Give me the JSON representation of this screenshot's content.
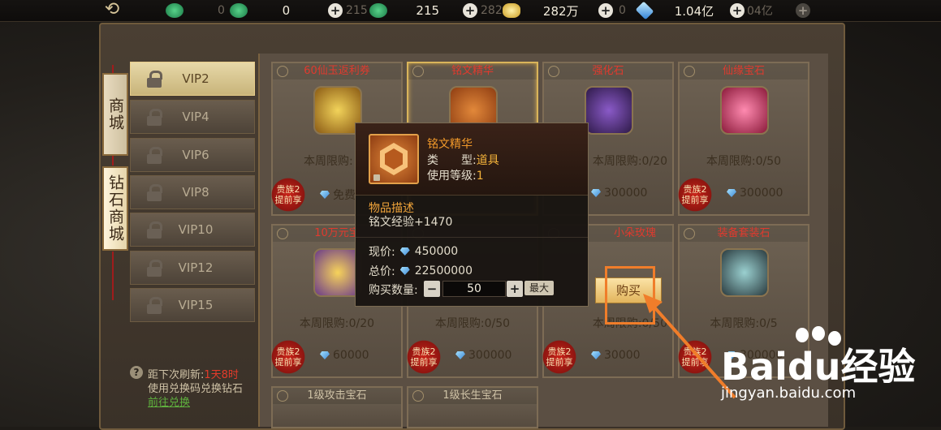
{
  "currencies": [
    {
      "prefix": "0",
      "value": "0"
    },
    {
      "prefix": "215",
      "value": "215"
    },
    {
      "prefix": "282",
      "value": "282万"
    },
    {
      "prefix": "0",
      "value": "1.04亿"
    }
  ],
  "ghost_value": "04亿",
  "side_tabs": {
    "shop": "商城",
    "diamond_shop": "钻石商城"
  },
  "vip_tabs": [
    "VIP2",
    "VIP4",
    "VIP6",
    "VIP8",
    "VIP10",
    "VIP12",
    "VIP15"
  ],
  "footer": {
    "refresh_prefix": "距下次刷新:",
    "refresh_time": "1天8时",
    "redeem_text": "使用兑换码兑换钻石",
    "redeem_link": "前往兑换"
  },
  "noble_badge": "贵族2\n提前享",
  "cards": [
    {
      "title": "60仙玉返利券",
      "limit": "本周限购:",
      "price": "免费"
    },
    {
      "title": "铭文精华",
      "limit": "",
      "price": ""
    },
    {
      "title": "强化石",
      "limit": "本周限购:0/20",
      "price": "300000"
    },
    {
      "title": "仙缘宝石",
      "limit": "本周限购:0/50",
      "price": "300000"
    },
    {
      "title": "10万元宝",
      "limit": "本周限购:0/20",
      "price": "60000"
    },
    {
      "title": "",
      "limit": "本周限购:0/50",
      "price": "300000"
    },
    {
      "title": "小朵玫瑰",
      "limit": "本周限购:0/50",
      "price": "30000"
    },
    {
      "title": "装备套装石",
      "limit": "本周限购:0/5",
      "price": "300000"
    },
    {
      "title": "1级攻击宝石"
    },
    {
      "title": "1级长生宝石"
    }
  ],
  "popup": {
    "name": "铭文精华",
    "type_label": "类　　型:",
    "type_value": "道具",
    "level_label": "使用等级:",
    "level_value": "1",
    "desc_title": "物品描述",
    "desc_text": "铭文经验+1470",
    "current_label": "现价:",
    "current_price": "450000",
    "total_label": "总价:",
    "total_price": "22500000",
    "qty_label": "购买数量:",
    "qty_value": "50",
    "max_label": "最大"
  },
  "buy_label": "购买",
  "watermark": {
    "brand": "Baidu经验",
    "url": "jingyan.baidu.com"
  }
}
